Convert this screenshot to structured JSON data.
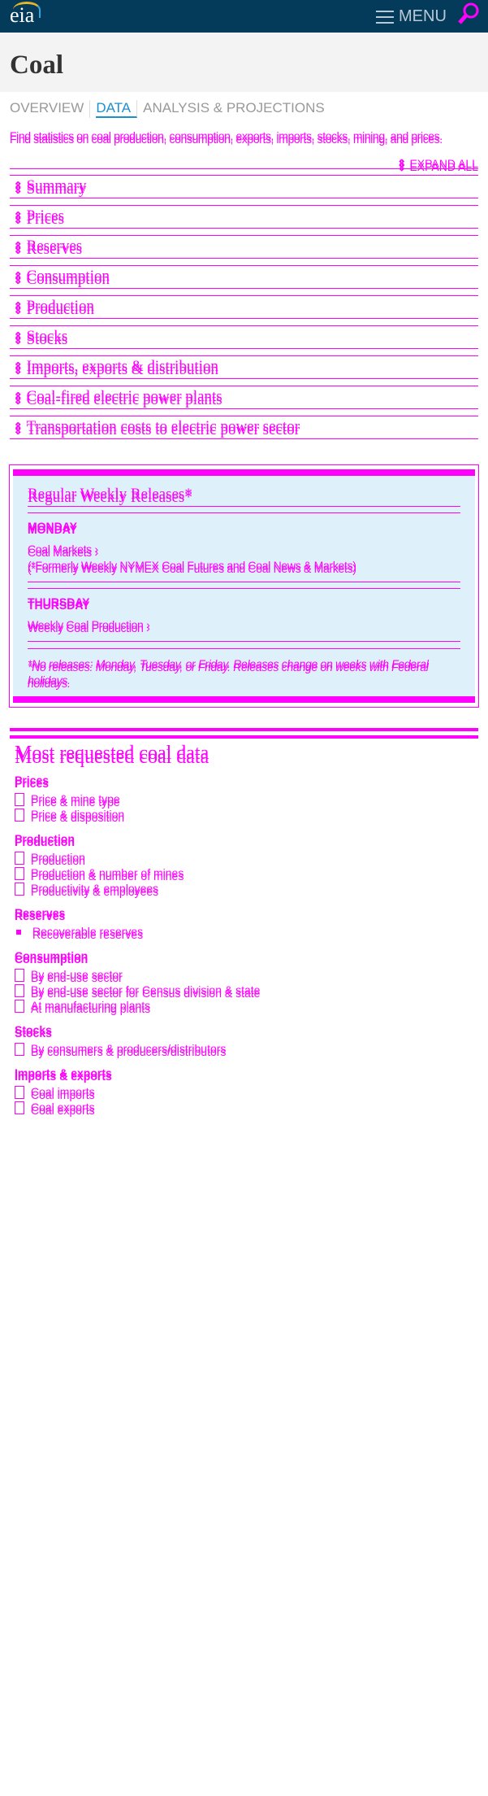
{
  "header": {
    "logo": "eia",
    "menu_label": "MENU",
    "search_icon": "search-icon",
    "menu_icon": "hamburger-icon"
  },
  "page": {
    "title": "Coal"
  },
  "tabs": [
    {
      "label": "OVERVIEW"
    },
    {
      "label": "DATA",
      "active": true
    },
    {
      "label": "ANALYSIS & PROJECTIONS"
    }
  ],
  "description": "Find statistics on coal production, consumption, exports, imports, stocks, mining, and prices.",
  "expand_all": "EXPAND ALL",
  "accordion": [
    "Summary",
    "Prices",
    "Reserves",
    "Consumption",
    "Production",
    "Stocks",
    "Imports, exports & distribution",
    "Coal-fired electric power plants",
    "Transportation costs to electric power sector"
  ],
  "weekly": {
    "title": "Regular Weekly Releases*",
    "monday": {
      "day": "MONDAY",
      "link": "Coal Markets ›",
      "note": "(*Formerly Weekly NYMEX Coal Futures and Coal News & Markets)"
    },
    "thursday": {
      "day": "THURSDAY",
      "link": "Weekly Coal Production ›"
    },
    "footnote": "*No releases: Monday, Tuesday, or Friday. Releases change on weeks with Federal holidays."
  },
  "most_requested": {
    "title": "Most requested coal data",
    "groups": [
      {
        "heading": "Prices",
        "items": [
          "Price & mine type",
          "Price & disposition"
        ]
      },
      {
        "heading": "Production",
        "items": [
          "Production",
          "Production & number of mines",
          "Productivity & employees"
        ]
      },
      {
        "heading": "Reserves",
        "items": [
          "Recoverable reserves"
        ]
      },
      {
        "heading": "Consumption",
        "items": [
          "By end-use sector",
          "By end-use sector for Census division & state",
          "At manufacturing plants"
        ]
      },
      {
        "heading": "Stocks",
        "items": [
          "By consumers & producers/distributors"
        ]
      },
      {
        "heading": "Imports & exports",
        "items": [
          "Coal imports",
          "Coal exports"
        ]
      }
    ]
  },
  "colors": {
    "header_bg": "#043a5a",
    "overlay": "#ff00ff",
    "active_tab": "#1c8fcf",
    "weekly_bg": "#def0f9"
  }
}
